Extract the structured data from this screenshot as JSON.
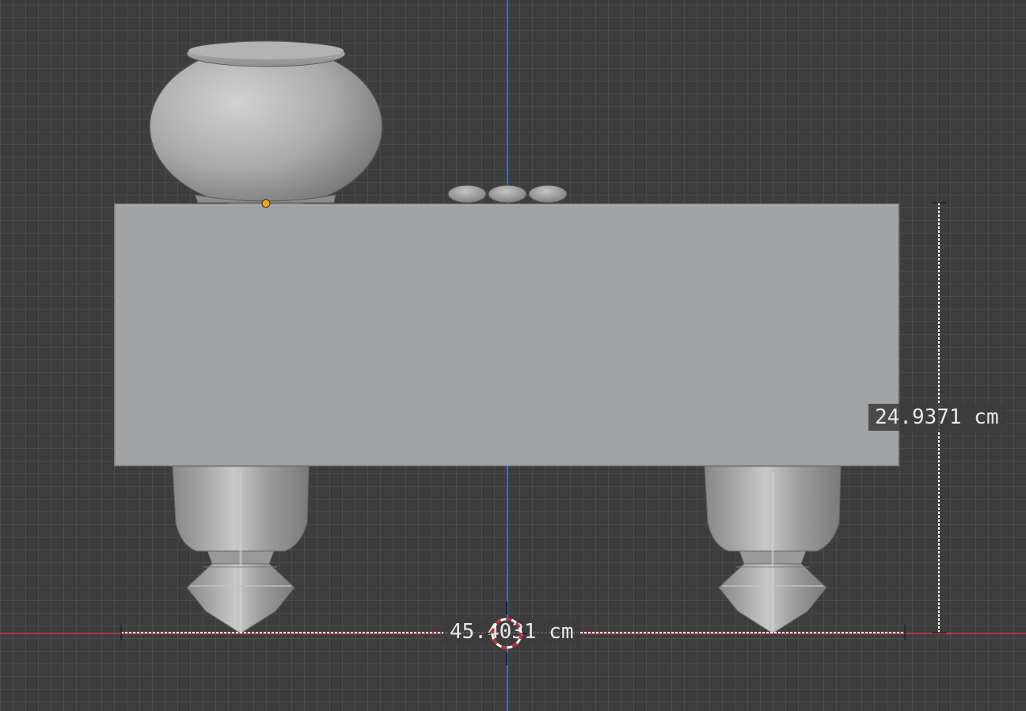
{
  "viewport": {
    "axis_x_color": "#b03c46",
    "axis_y_color": "#3f70b8",
    "background": "#3d3d3d"
  },
  "scene": {
    "objects": [
      "jar",
      "pebbles",
      "base-block",
      "legs"
    ],
    "origin_point_color": "#f5a623",
    "cursor_icon": "3d-cursor-icon"
  },
  "measurements": {
    "width_label": "45.4031 cm",
    "height_label": "24.9371 cm"
  }
}
